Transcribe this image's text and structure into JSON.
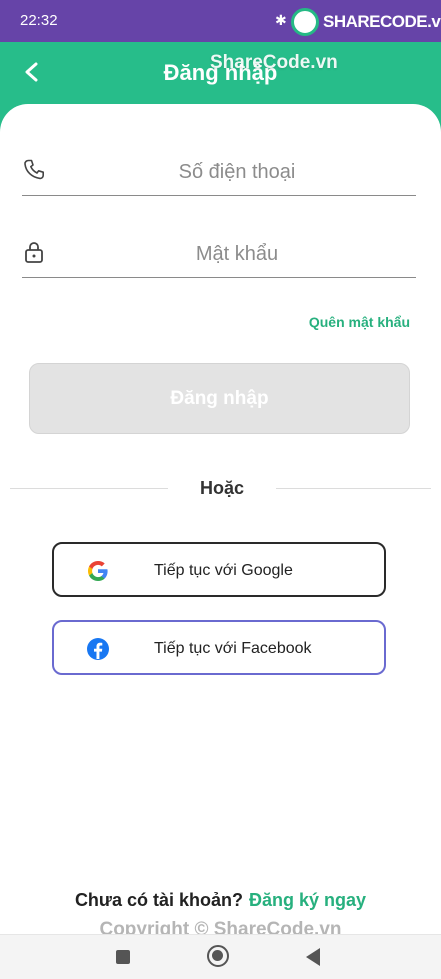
{
  "status_bar": {
    "time": "22:32",
    "logo_text": "SHARECODE.vn"
  },
  "header": {
    "title": "Đăng nhập",
    "watermark": "ShareCode.vn",
    "background": "#27bd8a"
  },
  "form": {
    "phone_placeholder": "Số điện thoại",
    "password_placeholder": "Mật khẩu",
    "forgot_label": "Quên mật khẩu",
    "login_label": "Đăng nhập"
  },
  "divider": {
    "label": "Hoặc"
  },
  "social": {
    "google_label": "Tiếp tục với Google",
    "facebook_label": "Tiếp tục với Facebook"
  },
  "footer": {
    "signup_prompt": "Chưa có tài khoản?",
    "signup_link": "Đăng ký ngay",
    "copyright": "Copyright © ShareCode.vn"
  },
  "colors": {
    "accent": "#27b07e",
    "status_bar": "#6644a8",
    "facebook": "#1877f2"
  },
  "icons": [
    "back-icon",
    "phone-icon",
    "lock-icon",
    "google-icon",
    "facebook-icon",
    "nav-recents-icon",
    "nav-home-icon",
    "nav-back-icon"
  ]
}
